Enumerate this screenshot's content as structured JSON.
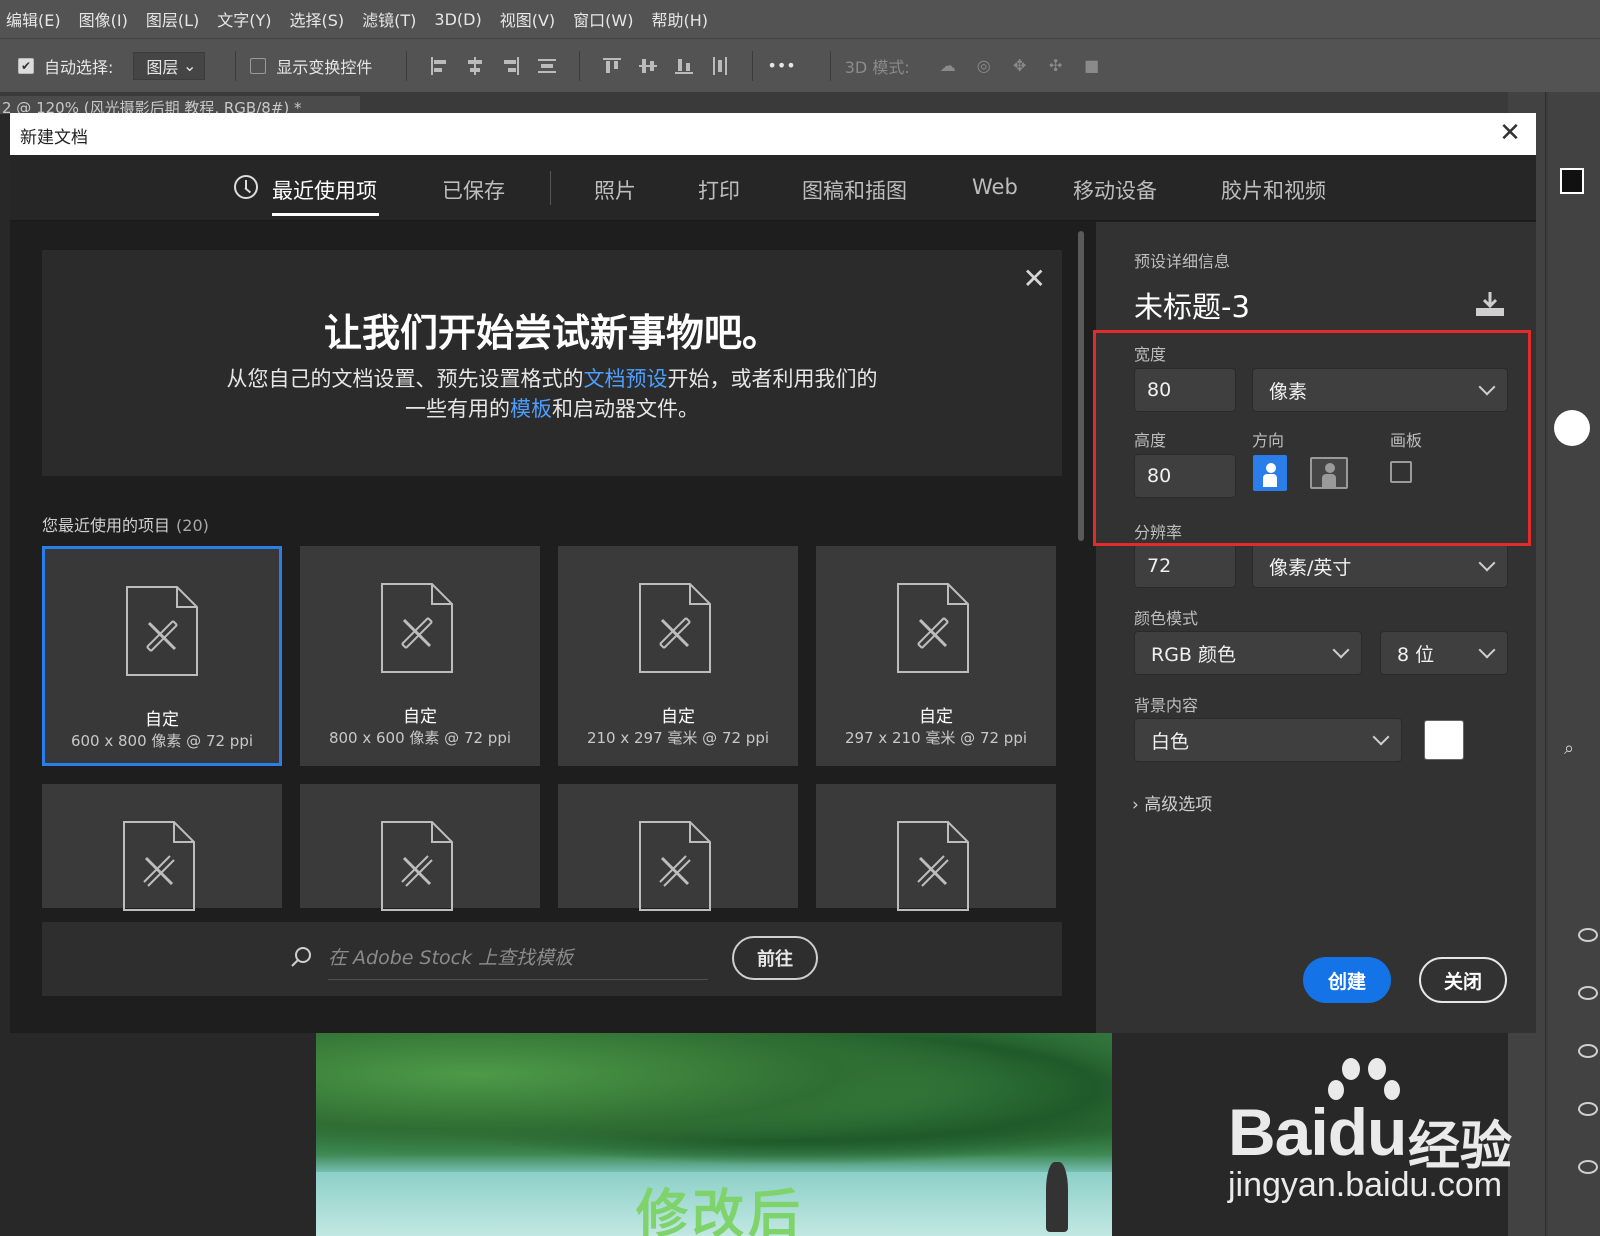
{
  "menubar": [
    "编辑(E)",
    "图像(I)",
    "图层(L)",
    "文字(Y)",
    "选择(S)",
    "滤镜(T)",
    "3D(D)",
    "视图(V)",
    "窗口(W)",
    "帮助(H)"
  ],
  "options": {
    "auto_select_label": "自动选择:",
    "auto_select_value": "图层",
    "show_transform_label": "显示变换控件",
    "more": "•••",
    "mode_3d_label": "3D 模式:"
  },
  "doc_tab": "2 @ 120% (风光摄影后期 教程, RGB/8#) *",
  "dialog": {
    "title": "新建文档",
    "tabs": [
      "最近使用项",
      "已保存",
      "照片",
      "打印",
      "图稿和插图",
      "Web",
      "移动设备",
      "胶片和视频"
    ],
    "welcome": {
      "title": "让我们开始尝试新事物吧。",
      "line1_a": "从您自己的文档设置、预先设置格式的",
      "line1_link": "文档预设",
      "line1_b": "开始，或者利用我们的",
      "line2_a": "一些有用的",
      "line2_link": "模板",
      "line2_b": "和启动器文件。"
    },
    "recent": {
      "heading": "您最近使用的项目",
      "count": "(20)",
      "items": [
        {
          "name": "自定",
          "dims": "600 x 800 像素 @ 72 ppi"
        },
        {
          "name": "自定",
          "dims": "800 x 600 像素 @ 72 ppi"
        },
        {
          "name": "自定",
          "dims": "210 x 297 毫米 @ 72 ppi"
        },
        {
          "name": "自定",
          "dims": "297 x 210 毫米 @ 72 ppi"
        }
      ]
    },
    "stock": {
      "placeholder": "在 Adobe Stock 上查找模板",
      "go": "前往"
    },
    "details": {
      "section": "预设详细信息",
      "preset_name": "未标题-3",
      "width_label": "宽度",
      "width_value": "80",
      "width_unit": "像素",
      "height_label": "高度",
      "height_value": "80",
      "orientation_label": "方向",
      "artboard_label": "画板",
      "resolution_label": "分辨率",
      "resolution_value": "72",
      "resolution_unit": "像素/英寸",
      "color_mode_label": "颜色模式",
      "color_mode": "RGB 颜色",
      "bit_depth": "8 位",
      "background_label": "背景内容",
      "background": "白色",
      "background_swatch": "#ffffff",
      "advanced": "高级选项",
      "create": "创建",
      "close": "关闭"
    }
  },
  "canvas": {
    "caption": "修改后"
  },
  "watermark": {
    "brand": "Bai",
    "brand_du": "du",
    "brand_cn": "经验",
    "url": "jingyan.baidu.com"
  },
  "colors": {
    "accent_blue": "#1473e6",
    "selection_blue": "#2b7de9",
    "link_blue": "#4d9eff",
    "highlight_red": "#e22b2b"
  }
}
